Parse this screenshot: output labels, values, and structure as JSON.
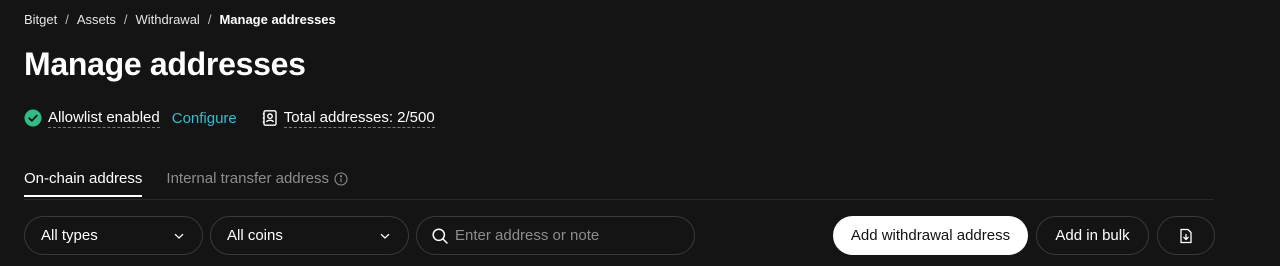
{
  "breadcrumb": {
    "items": [
      "Bitget",
      "Assets",
      "Withdrawal"
    ],
    "current": "Manage addresses",
    "separator": "/"
  },
  "page_title": "Manage addresses",
  "status": {
    "allowlist_label": "Allowlist enabled",
    "configure_link": "Configure",
    "total_addresses": "Total addresses: 2/500"
  },
  "tabs": [
    {
      "label": "On-chain address",
      "active": true
    },
    {
      "label": "Internal transfer address",
      "active": false
    }
  ],
  "filters": {
    "type_select": "All types",
    "coin_select": "All coins",
    "search_placeholder": "Enter address or note"
  },
  "actions": {
    "add_withdrawal": "Add withdrawal address",
    "add_bulk": "Add in bulk",
    "export_icon": "file-download-icon"
  },
  "colors": {
    "background": "#141414",
    "accent": "#25c2d7",
    "success": "#2ebd85"
  }
}
